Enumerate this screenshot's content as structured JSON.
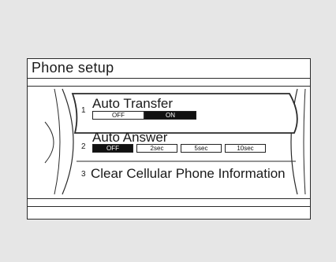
{
  "screen": {
    "title": "Phone setup",
    "items": [
      {
        "number": "1",
        "label": "Auto Transfer",
        "options": [
          {
            "label": "OFF",
            "selected": false
          },
          {
            "label": "ON",
            "selected": true
          }
        ]
      },
      {
        "number": "2",
        "label": "Auto Answer",
        "options": [
          {
            "label": "OFF",
            "selected": true
          },
          {
            "label": "2sec",
            "selected": false
          },
          {
            "label": "5sec",
            "selected": false
          },
          {
            "label": "10sec",
            "selected": false
          }
        ]
      },
      {
        "number": "3",
        "label": "Clear Cellular Phone Information"
      }
    ]
  },
  "colors": {
    "background": "#e6e6e6",
    "screen": "#ffffff",
    "ink": "#1a1a1a",
    "selected": "#111111"
  }
}
